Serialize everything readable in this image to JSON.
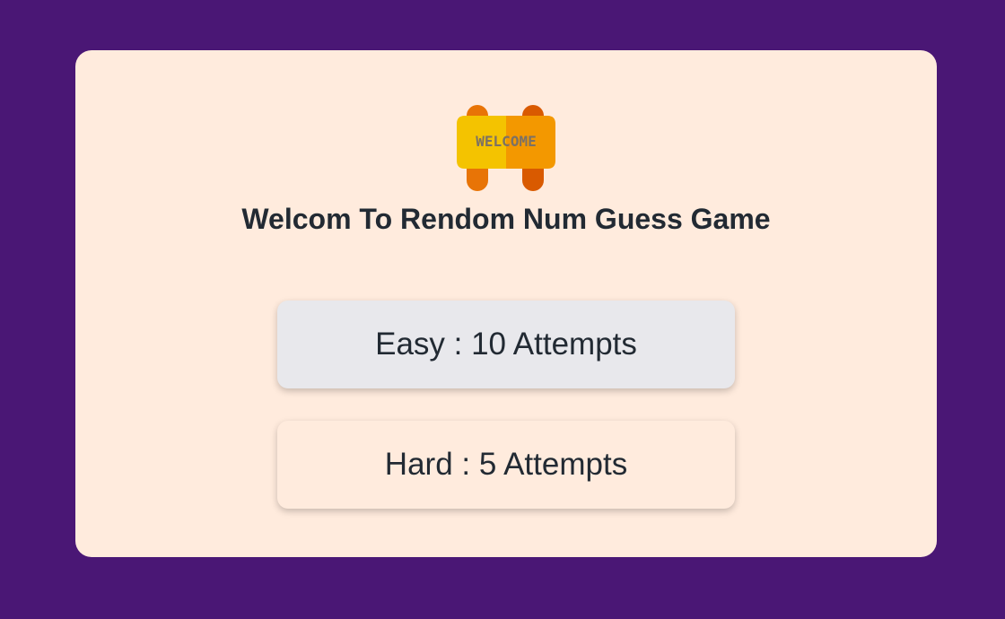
{
  "page": {
    "background_color": "#4a1775",
    "card_color": "#ffebdd"
  },
  "logo": {
    "icon": "welcome-sign-icon",
    "text": "WELCOME"
  },
  "header": {
    "title": "Welcom To Rendom Num Guess Game"
  },
  "modes": {
    "easy_label": "Easy : 10 Attempts",
    "hard_label": "Hard : 5 Attempts"
  }
}
